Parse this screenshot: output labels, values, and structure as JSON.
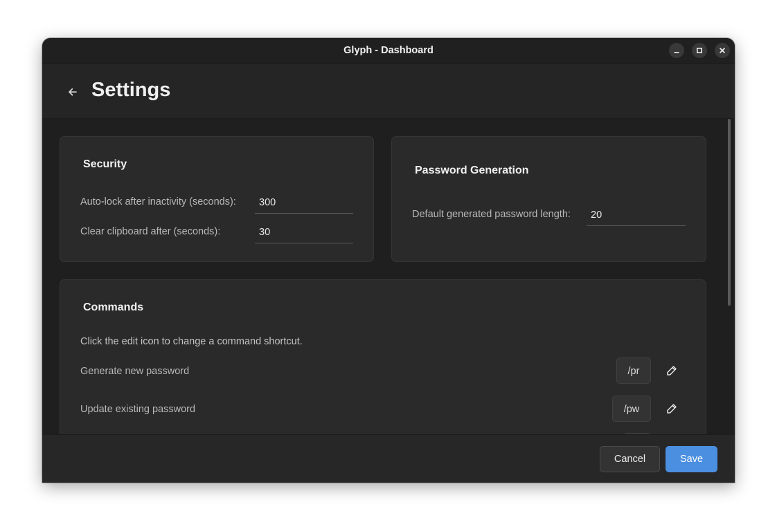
{
  "window": {
    "title": "Glyph - Dashboard"
  },
  "window_controls": [
    "minimize-icon",
    "maximize-icon",
    "close-icon"
  ],
  "header": {
    "title": "Settings",
    "back_icon": "arrow-left-icon"
  },
  "security": {
    "title": "Security",
    "fields": [
      {
        "label": "Auto-lock after inactivity (seconds):",
        "value": "300"
      },
      {
        "label": "Clear clipboard after (seconds):",
        "value": "30"
      }
    ]
  },
  "password_generation": {
    "title": "Password Generation",
    "fields": [
      {
        "label": "Default generated password length:",
        "value": "20"
      }
    ]
  },
  "commands": {
    "title": "Commands",
    "hint": "Click the edit icon to change a command shortcut.",
    "items": [
      {
        "label": "Generate new password",
        "shortcut": "/pr",
        "edit_icon": "pencil-icon"
      },
      {
        "label": "Update existing password",
        "shortcut": "/pw",
        "edit_icon": "pencil-icon"
      }
    ]
  },
  "footer": {
    "cancel_label": "Cancel",
    "save_label": "Save"
  },
  "colors": {
    "accent": "#4a8fe0",
    "background": "#1f1f1f",
    "card": "#2a2a2a"
  }
}
